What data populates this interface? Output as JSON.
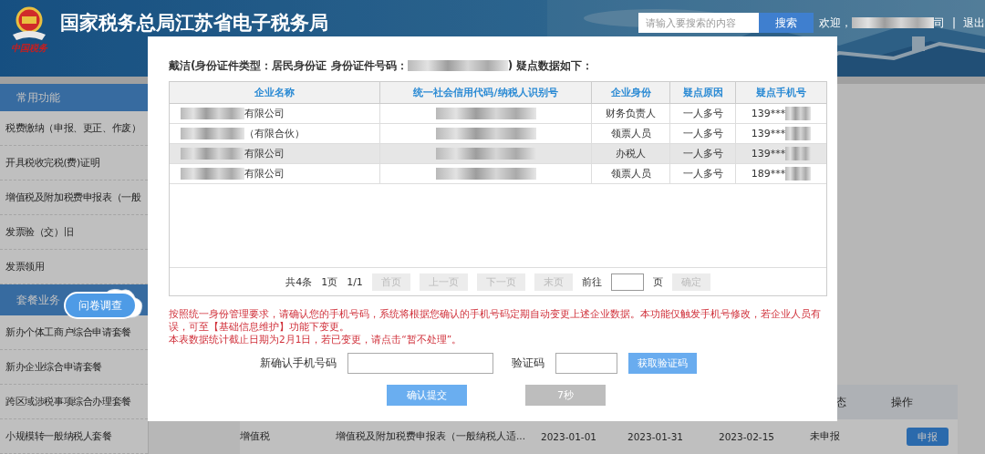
{
  "header": {
    "title": "国家税务总局江苏省电子税务局",
    "logo_caption": "中国税务",
    "search": {
      "placeholder": "请输入要搜索的内容",
      "button": "搜索"
    },
    "welcome": "欢迎，",
    "user_tail": "司",
    "separator": "|",
    "logout": "退出"
  },
  "sidebar": [
    {
      "title": "常用功能",
      "items": [
        "税费缴纳（申报、更正、作废）",
        "开具税收完税(费)证明",
        "增值税及附加税费申报表（一般",
        "发票验（交）旧",
        "发票领用"
      ]
    },
    {
      "title": "套餐业务",
      "items": [
        "新办个体工商户综合申请套餐",
        "新办企业综合申请套餐",
        "跨区域涉税事项综合办理套餐",
        "小规模转一般纳税人套餐"
      ]
    }
  ],
  "survey_badge": "问卷调查",
  "main_table": {
    "columns": [
      "态",
      "操作"
    ],
    "rows": [
      {
        "cells": [
          "增值税",
          "增值税及附加税费申报表（一般纳税人适...",
          "2023-01-01",
          "2023-01-31",
          "2023-02-15",
          "未申报"
        ],
        "action": "申报"
      }
    ]
  },
  "modal": {
    "heading_prefix": "戴洁(身份证件类型：居民身份证 身份证件号码：",
    "heading_suffix": ") 疑点数据如下：",
    "columns": [
      "企业名称",
      "统一社会信用代码/纳税人识别号",
      "企业身份",
      "疑点原因",
      "疑点手机号"
    ],
    "rows": [
      {
        "company": "有限公司",
        "role": "财务负责人",
        "reason": "一人多号",
        "phone": "139***",
        "selected": false
      },
      {
        "company": "（有限合伙）",
        "role": "领票人员",
        "reason": "一人多号",
        "phone": "139***",
        "selected": false
      },
      {
        "company": "有限公司",
        "role": "办税人",
        "reason": "一人多号",
        "phone": "139***",
        "selected": true
      },
      {
        "company": "有限公司",
        "role": "领票人员",
        "reason": "一人多号",
        "phone": "189***",
        "selected": false
      }
    ],
    "pagination": {
      "total": "共4条",
      "pages": "1页",
      "current": "1/1",
      "buttons": [
        {
          "label": "首页",
          "disabled": true
        },
        {
          "label": "上一页",
          "disabled": true
        },
        {
          "label": "下一页",
          "disabled": true
        },
        {
          "label": "末页",
          "disabled": true
        }
      ],
      "goto": "前往",
      "unit": "页",
      "confirm": {
        "label": "确定",
        "disabled": true
      }
    },
    "notice": [
      "按照统一身份管理要求，请确认您的手机号码，系统将根据您确认的手机号码定期自动变更上述企业数据。本功能仅触发手机号修改，若企业人员有误，可至【基础信息维护】功能下变更。",
      "本表数据统计截止日期为2月1日，若已变更，请点击“暂不处理”。"
    ],
    "form": {
      "phone_label": "新确认手机号码",
      "code_label": "验证码",
      "get_code": "获取验证码"
    },
    "submit": {
      "label": "确认提交",
      "disabled": false
    },
    "countdown": {
      "label": "7秒",
      "disabled": true
    }
  }
}
